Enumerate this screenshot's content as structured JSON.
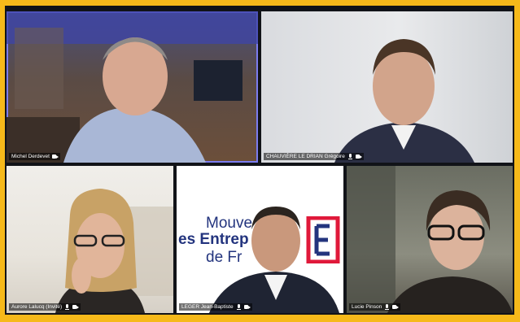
{
  "participants": [
    {
      "name": "Michel Derdevet",
      "active": true
    },
    {
      "name": "CHAUVIÈRE LE DRIAN Grégoire",
      "active": false
    },
    {
      "name": "Aurore Lalucq (Invité)",
      "active": false
    },
    {
      "name": "LEGER Jean-Baptiste",
      "active": false
    },
    {
      "name": "Lucie Pinson",
      "active": false
    }
  ],
  "background_logo": {
    "line1": "Mouve",
    "line2": "es Entrep",
    "line3": "de Fr"
  },
  "colors": {
    "border": "#f6b91a",
    "active_speaker": "#7b7cf0",
    "logo_blue": "#23347e",
    "logo_red": "#e0193a"
  }
}
